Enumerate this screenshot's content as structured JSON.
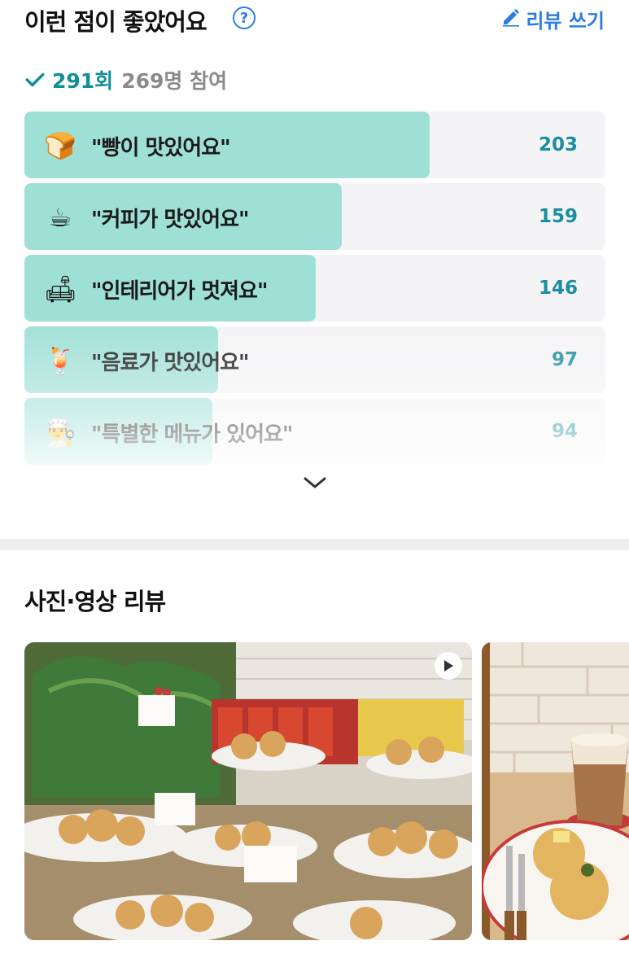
{
  "header": {
    "title": "이런 점이 좋았어요",
    "help_icon": "?",
    "write_label": "리뷰 쓰기"
  },
  "summary": {
    "count": "291회",
    "participants": "269명 참여"
  },
  "votes": [
    {
      "emoji": "🍞",
      "label": "\"빵이 맛있어요\"",
      "count": "203",
      "fraction": 0.698
    },
    {
      "emoji": "☕",
      "label": "\"커피가 맛있어요\"",
      "count": "159",
      "fraction": 0.546
    },
    {
      "emoji": "🛋",
      "label": "\"인테리어가 멋져요\"",
      "count": "146",
      "fraction": 0.502
    },
    {
      "emoji": "🍹",
      "label": "\"음료가 맛있어요\"",
      "count": "97",
      "fraction": 0.333
    },
    {
      "emoji": "👨‍🍳",
      "label": "\"특별한 메뉴가 있어요\"",
      "count": "94",
      "fraction": 0.323
    }
  ],
  "photo_section": {
    "title": "사진·영상 리뷰"
  },
  "colors": {
    "accent_blue": "#2a7de1",
    "accent_teal": "#1a8ea0",
    "bar_fill": "#9fe0d6",
    "bar_bg": "#f4f4f6"
  }
}
